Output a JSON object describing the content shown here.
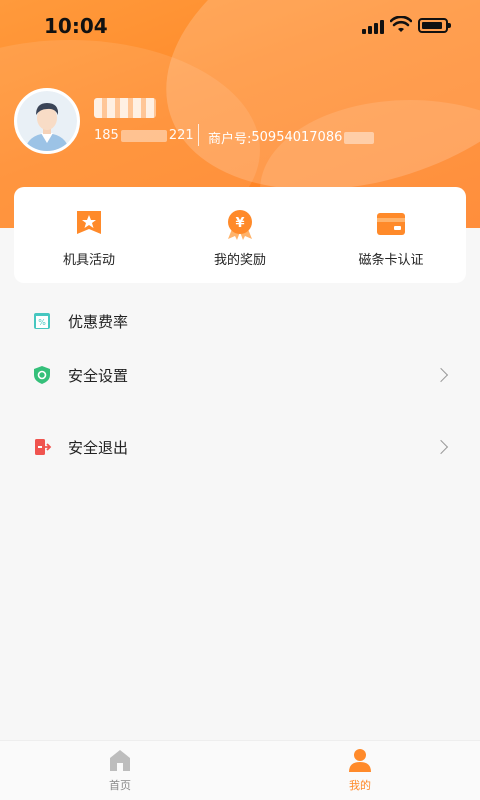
{
  "status_bar": {
    "time": "10:04"
  },
  "profile": {
    "phone_prefix": "185",
    "phone_suffix": "221",
    "merchant_label": "商户号:",
    "merchant_number": "50954017086"
  },
  "quick_actions": [
    {
      "label": "机具活动",
      "icon": "flag-star-icon"
    },
    {
      "label": "我的奖励",
      "icon": "yuan-medal-icon"
    },
    {
      "label": "磁条卡认证",
      "icon": "card-icon"
    }
  ],
  "menu": [
    {
      "label": "优惠费率",
      "icon": "discount-ticket-icon"
    },
    {
      "label": "安全设置",
      "icon": "shield-icon"
    },
    {
      "label": "安全退出",
      "icon": "exit-icon"
    }
  ],
  "tabs": [
    {
      "label": "首页",
      "icon": "home-icon"
    },
    {
      "label": "我的",
      "icon": "person-icon",
      "active": true
    }
  ],
  "colors": {
    "brand": "#ff8a2a",
    "tab_inactive": "#8a8a8a"
  }
}
